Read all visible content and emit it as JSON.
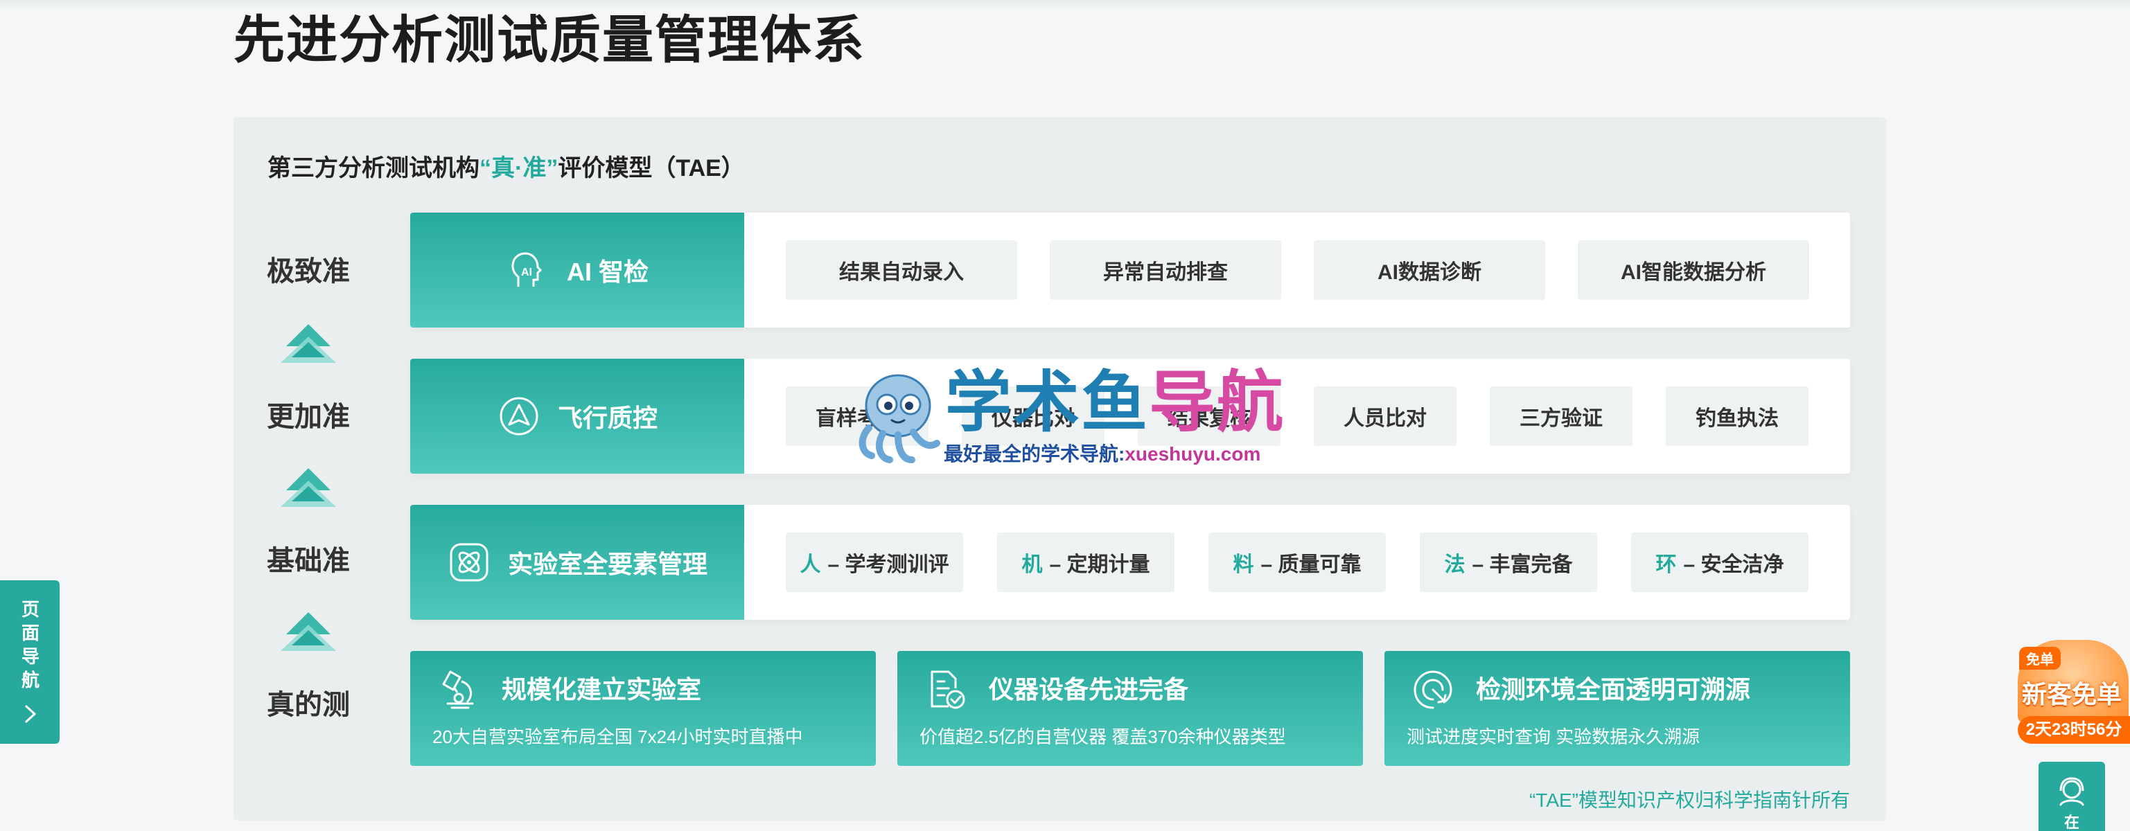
{
  "page": {
    "title": "先进分析测试质量管理体系"
  },
  "model": {
    "title_prefix": "第三方分析测试机构",
    "title_accent": "“真·准”",
    "title_suffix": "评价模型（TAE）"
  },
  "levels": [
    {
      "label": "极致准"
    },
    {
      "label": "更加准"
    },
    {
      "label": "基础准"
    },
    {
      "label": "真的测"
    }
  ],
  "rows": [
    {
      "head": "AI 智检",
      "icon": "ai-head-icon",
      "chips": [
        "结果自动录入",
        "异常自动排查",
        "AI数据诊断",
        "AI智能数据分析"
      ]
    },
    {
      "head": "飞行质控",
      "icon": "flight-control-icon",
      "chips": [
        "盲样考核",
        "仪器比对",
        "结果复核",
        "人员比对",
        "三方验证",
        "钓鱼执法"
      ]
    },
    {
      "head": "实验室全要素管理",
      "icon": "atom-icon",
      "chips": [
        {
          "kw": "人",
          "text": "– 学考测训评"
        },
        {
          "kw": "机",
          "text": "– 定期计量"
        },
        {
          "kw": "料",
          "text": "– 质量可靠"
        },
        {
          "kw": "法",
          "text": "– 丰富完备"
        },
        {
          "kw": "环",
          "text": "– 安全洁净"
        }
      ]
    }
  ],
  "cards": [
    {
      "title": "规模化建立实验室",
      "desc": "20大自营实验室布局全国 7x24小时实时直播中",
      "icon": "microscope-icon"
    },
    {
      "title": "仪器设备先进完备",
      "desc": "价值超2.5亿的自营仪器 覆盖370余种仪器类型",
      "icon": "document-check-icon"
    },
    {
      "title": "检测环境全面透明可溯源",
      "desc": "测试进度实时查询 实验数据永久溯源",
      "icon": "trace-icon"
    }
  ],
  "footnote": "“TAE”模型知识产权归科学指南针所有",
  "watermark": {
    "title_a": "学术鱼",
    "title_b": "导航",
    "subtitle": "最好最全的学术导航:",
    "url": "xueshuyu.com"
  },
  "side_nav": {
    "label": "页面导航",
    "icon": "chevron-right-icon"
  },
  "promo": {
    "tag": "免单",
    "main": "新客免单",
    "countdown": "2天23时56分"
  },
  "service": {
    "label": "在"
  },
  "colors": {
    "accent": "#23aa9c",
    "accent_light": "#4ec8bb",
    "panel": "#eaeeef",
    "chip": "#eef2f3"
  }
}
